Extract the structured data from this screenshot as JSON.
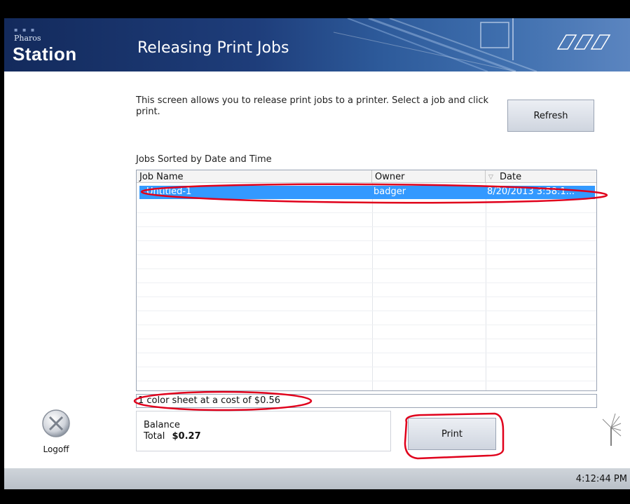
{
  "header": {
    "logo_small": "Pharos",
    "logo_big": "Station",
    "title": "Releasing Print Jobs"
  },
  "intro_text": "This screen allows you to release print jobs to a printer. Select a job and click print.",
  "refresh_label": "Refresh",
  "jobs_label": "Jobs Sorted by Date and Time",
  "table": {
    "columns": [
      "Job Name",
      "Owner",
      "Date"
    ],
    "rows": [
      {
        "job": "Untitled-1",
        "owner": "badger",
        "date": "8/20/2013 3:58:1..."
      }
    ]
  },
  "cost_text": "1 color sheet at a cost of $0.56",
  "balance": {
    "label": "Balance",
    "total_label": "Total",
    "total_value": "$0.27"
  },
  "print_label": "Print",
  "logoff_label": "Logoff",
  "clock": "4:12:44 PM",
  "colors": {
    "header_bg": "#1e3d7a",
    "selection": "#3399ff",
    "annotation": "#e0001b"
  }
}
